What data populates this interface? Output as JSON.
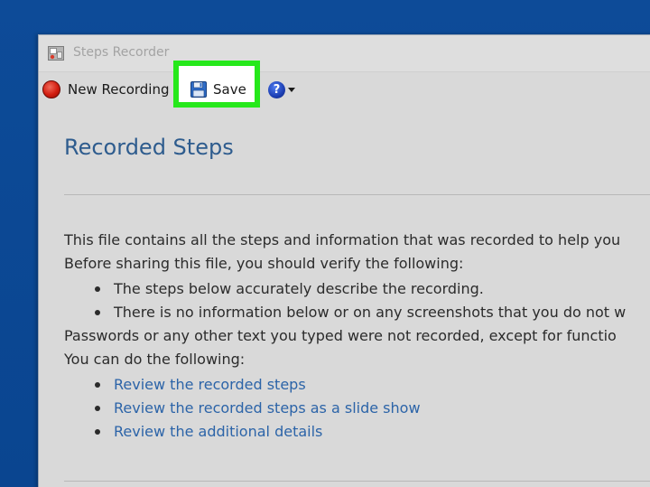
{
  "window": {
    "title": "Steps Recorder"
  },
  "toolbar": {
    "new_recording_label": "New Recording",
    "save_label": "Save",
    "help_label": "?"
  },
  "content": {
    "heading": "Recorded Steps",
    "intro_line_1": "This file contains all the steps and information that was recorded to help you",
    "intro_line_2": "Before sharing this file, you should verify the following:",
    "verify_items": [
      "The steps below accurately describe the recording.",
      "There is no information below or on any screenshots that you do not w"
    ],
    "passwords_line": "Passwords or any other text you typed were not recorded, except for functio",
    "can_do_line": "You can do the following:",
    "links": [
      "Review the recorded steps",
      "Review the recorded steps as a slide show",
      "Review the additional details"
    ]
  },
  "colors": {
    "desktop_bg": "#0c4a97",
    "highlight": "#26e81b",
    "heading": "#2e5c8e",
    "link": "#2c64a8"
  },
  "icons": {
    "app": "steps-recorder-app-icon",
    "record": "record-icon",
    "save": "floppy-disk-icon",
    "help": "help-icon",
    "dropdown": "chevron-down-icon"
  }
}
